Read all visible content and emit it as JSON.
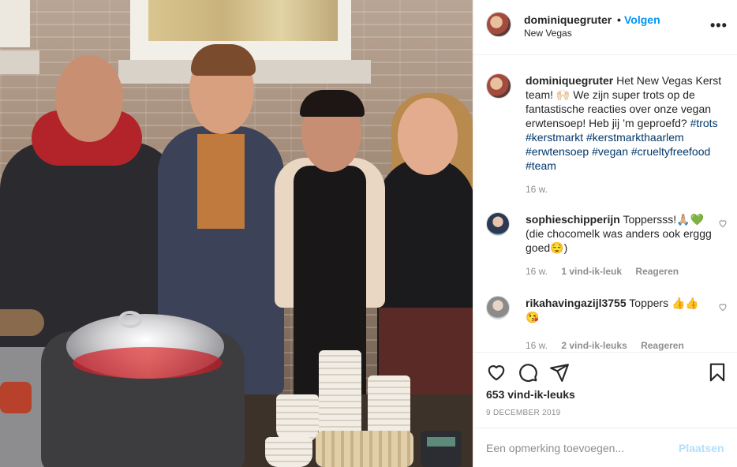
{
  "post": {
    "username": "dominiquegruter",
    "dot": "•",
    "follow_label": "Volgen",
    "location": "New Vegas",
    "more_label": "•••",
    "caption": {
      "username": "dominiquegruter",
      "text_before": " Het New Vegas Kerst team! 🙌🏻 We zijn super trots op de fantastische reacties over onze vegan erwtensoep! Heb jij ’m geproefd? ",
      "hashtags": [
        "#trots",
        "#kerstmarkt",
        "#kerstmarkthaarlem",
        "#erwtensoep",
        "#vegan",
        "#crueltyfreefood",
        "#team"
      ],
      "time": "16 w."
    },
    "comments": [
      {
        "username": "sophieschipperijn",
        "text": " Toppersss!🙏🏼💚 (die chocomelk was anders ook erggg goed😌)",
        "time": "16 w.",
        "likes": "1 vind-ik-leuk",
        "reply": "Reageren"
      },
      {
        "username": "rikahavingazijl3755",
        "text": " Toppers 👍👍😘",
        "time": "16 w.",
        "likes": "2 vind-ik-leuks",
        "reply": "Reageren"
      }
    ],
    "likes_count": "653 vind-ik-leuks",
    "date": "9 DECEMBER 2019",
    "add_comment_placeholder": "Een opmerking toevoegen...",
    "post_button": "Plaatsen"
  },
  "icons": {
    "like": "heart-icon",
    "comment": "comment-icon",
    "share": "paper-plane-icon",
    "save": "bookmark-icon"
  },
  "colors": {
    "link_blue": "#0095f6",
    "hashtag": "#00376b",
    "muted": "#8e8e8e",
    "post_disabled": "#b2dffc"
  }
}
